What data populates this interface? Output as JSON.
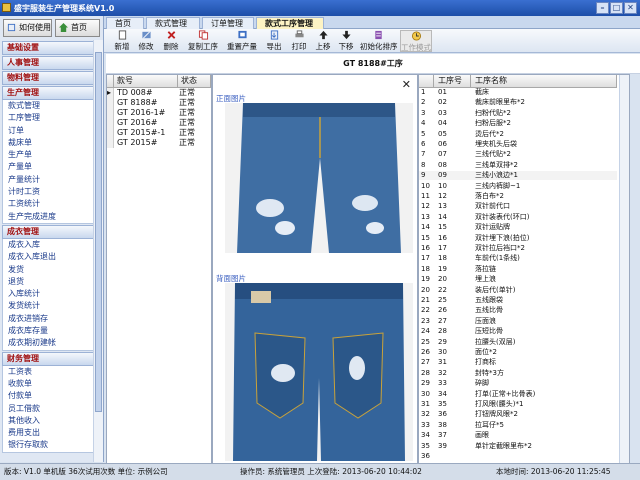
{
  "app": {
    "title": "盛宇服装生产管理系统V1.0"
  },
  "top_buttons": {
    "help": "如何使用",
    "home": "首页"
  },
  "nav": [
    {
      "section": "基础设置",
      "items": []
    },
    {
      "section": "人事管理",
      "items": []
    },
    {
      "section": "物料管理",
      "items": []
    },
    {
      "section": "生产管理",
      "items": [
        "款式管理",
        "工序管理",
        "订单",
        "裁床单",
        "生产单",
        "产量单",
        "产量统计",
        "计时工资",
        "工资统计",
        "生产完成进度"
      ]
    },
    {
      "section": "成衣管理",
      "items": [
        "成衣入库",
        "成衣入库退出",
        "发货",
        "退货",
        "入库统计",
        "发货统计",
        "成衣进销存",
        "成衣库存量",
        "成衣期初建帐"
      ]
    },
    {
      "section": "财务管理",
      "items": [
        "工资表",
        "收款单",
        "付款单",
        "员工借款",
        "其他收入",
        "费用支出",
        "银行存取款"
      ]
    }
  ],
  "tabs": [
    {
      "label": "首页",
      "active": false
    },
    {
      "label": "款式管理",
      "active": false
    },
    {
      "label": "订单管理",
      "active": false
    },
    {
      "label": "款式工序管理",
      "active": true
    }
  ],
  "toolbar": [
    {
      "label": "新增",
      "icon": "new-doc-icon"
    },
    {
      "label": "修改",
      "icon": "edit-icon"
    },
    {
      "label": "删除",
      "icon": "delete-x-icon"
    },
    {
      "label": "复制工序",
      "icon": "copy-icon"
    },
    {
      "label": "重置产量",
      "icon": "reset-icon"
    },
    {
      "label": "导出",
      "icon": "export-icon"
    },
    {
      "label": "打印",
      "icon": "print-icon"
    },
    {
      "label": "上移",
      "icon": "arrow-up-icon"
    },
    {
      "label": "下移",
      "icon": "arrow-down-icon"
    },
    {
      "label": "初始化排序",
      "icon": "sort-icon"
    },
    {
      "label": "工作模式",
      "icon": "clock-icon",
      "disabled": true
    }
  ],
  "heading": "GT 8188#工序",
  "styles_table": {
    "columns": [
      "款号",
      "状态"
    ],
    "rows": [
      [
        "TD 008#",
        "正常"
      ],
      [
        "GT 8188#",
        "正常"
      ],
      [
        "GT 2016-1#",
        "正常"
      ],
      [
        "GT 2016#",
        "正常"
      ],
      [
        "GT 2015#-1",
        "正常"
      ],
      [
        "GT 2015#",
        "正常"
      ]
    ]
  },
  "images": {
    "front_label": "正面图片",
    "back_label": "背面图片"
  },
  "process_table": {
    "columns": [
      "工序号",
      "工序名称"
    ],
    "rows": [
      [
        "1",
        "01",
        "截床"
      ],
      [
        "2",
        "02",
        "裁床前眼里布*2"
      ],
      [
        "3",
        "03",
        "扫粉代贴*2"
      ],
      [
        "4",
        "04",
        "扫粉后服*2"
      ],
      [
        "5",
        "05",
        "烫后代*2"
      ],
      [
        "6",
        "06",
        "埋夹机头后袋"
      ],
      [
        "7",
        "07",
        "三线代贴*2"
      ],
      [
        "8",
        "08",
        "三线单双排*2"
      ],
      [
        "9",
        "09",
        "三线小浪边*1"
      ],
      [
        "10",
        "10",
        "三线内裤脚~1"
      ],
      [
        "11",
        "12",
        "落白布*2"
      ],
      [
        "12",
        "13",
        "双针前代口"
      ],
      [
        "13",
        "14",
        "双针装表代(环口)"
      ],
      [
        "14",
        "15",
        "双针运贴牌"
      ],
      [
        "15",
        "16",
        "双针埋下浪(拍位)"
      ],
      [
        "16",
        "17",
        "双针拉后裆口*2"
      ],
      [
        "17",
        "18",
        "车前代(1条线)"
      ],
      [
        "18",
        "19",
        "落拉链"
      ],
      [
        "19",
        "20",
        "埋上浪"
      ],
      [
        "20",
        "22",
        "装后代(单针)"
      ],
      [
        "21",
        "25",
        "五线跟袋"
      ],
      [
        "22",
        "26",
        "五线比骨"
      ],
      [
        "23",
        "27",
        "压面浪"
      ],
      [
        "24",
        "28",
        "压短比骨"
      ],
      [
        "25",
        "29",
        "拉腰头(双层)"
      ],
      [
        "26",
        "30",
        "面位*2"
      ],
      [
        "27",
        "31",
        "打商标"
      ],
      [
        "28",
        "32",
        "封特*3方"
      ],
      [
        "29",
        "33",
        "碎脚"
      ],
      [
        "30",
        "34",
        "打单(正常+比骨表)"
      ],
      [
        "31",
        "35",
        "打风眼(腰头)*1"
      ],
      [
        "32",
        "36",
        "打钮牌风眼*2"
      ],
      [
        "33",
        "38",
        "拉耳仔*5"
      ],
      [
        "34",
        "37",
        "画眼"
      ],
      [
        "35",
        "39",
        "单针定截眼里布*2"
      ],
      [
        "36",
        "",
        ""
      ]
    ]
  },
  "status": {
    "version": "版本: V1.0 单机版 36次试用次数 单位: 示例公司",
    "operator": "操作员: 系统管理员 上次登陆: 2013-06-20 10:44:02",
    "local_time": "本地时间: 2013-06-20 11:25:45"
  },
  "colors": {
    "accent": "#1d4ea8",
    "nav_section": "#a01010",
    "tab_active": "#fdf3c4"
  }
}
